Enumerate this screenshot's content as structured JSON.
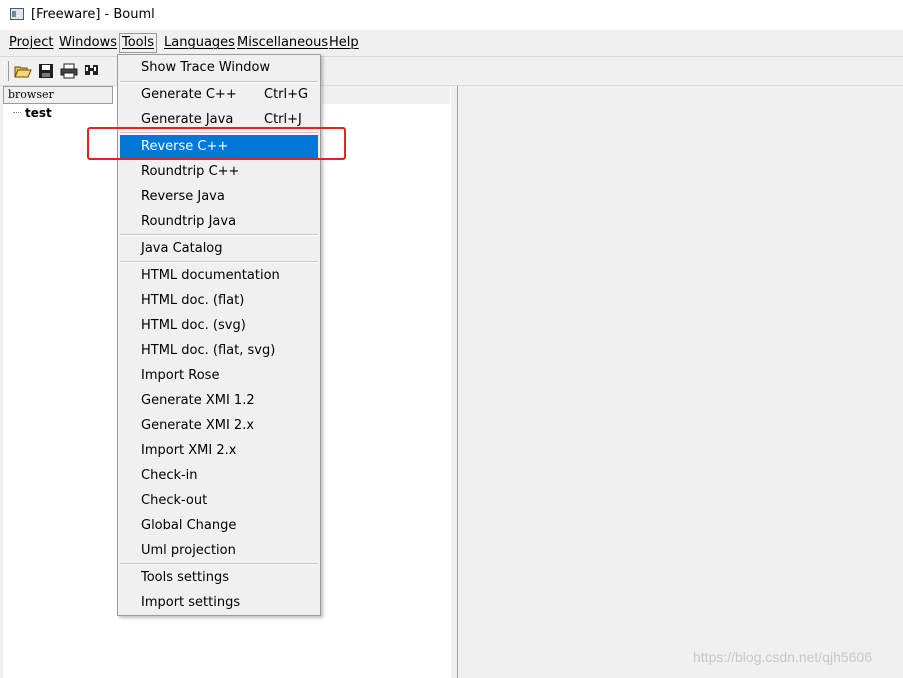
{
  "window": {
    "title": "[Freeware] - Bouml"
  },
  "menubar": {
    "items": [
      {
        "label": "Project"
      },
      {
        "label": "Windows"
      },
      {
        "label": "Tools"
      },
      {
        "label": "Languages"
      },
      {
        "label": "Miscellaneous"
      },
      {
        "label": "Help"
      }
    ]
  },
  "toolbar": {
    "buttons": [
      "open-folder-icon",
      "save-icon",
      "print-icon",
      "find-icon"
    ]
  },
  "browser": {
    "header": "browser",
    "root_node": "test"
  },
  "tools_menu": {
    "items": [
      {
        "label": "Show Trace Window",
        "shortcut": ""
      },
      {
        "label": "Generate C++",
        "shortcut": "Ctrl+G"
      },
      {
        "label": "Generate Java",
        "shortcut": "Ctrl+J"
      },
      {
        "label": "Reverse C++",
        "shortcut": "",
        "selected": true
      },
      {
        "label": "Roundtrip C++",
        "shortcut": ""
      },
      {
        "label": "Reverse Java",
        "shortcut": ""
      },
      {
        "label": "Roundtrip Java",
        "shortcut": ""
      },
      {
        "label": "Java Catalog",
        "shortcut": ""
      },
      {
        "label": "HTML documentation",
        "shortcut": ""
      },
      {
        "label": "HTML doc. (flat)",
        "shortcut": ""
      },
      {
        "label": "HTML doc. (svg)",
        "shortcut": ""
      },
      {
        "label": "HTML doc. (flat, svg)",
        "shortcut": ""
      },
      {
        "label": "Import Rose",
        "shortcut": ""
      },
      {
        "label": "Generate XMI 1.2",
        "shortcut": ""
      },
      {
        "label": "Generate XMI 2.x",
        "shortcut": ""
      },
      {
        "label": "Import XMI 2.x",
        "shortcut": ""
      },
      {
        "label": "Check-in",
        "shortcut": ""
      },
      {
        "label": "Check-out",
        "shortcut": ""
      },
      {
        "label": "Global Change",
        "shortcut": ""
      },
      {
        "label": "Uml projection",
        "shortcut": ""
      },
      {
        "label": "Tools settings",
        "shortcut": ""
      },
      {
        "label": "Import settings",
        "shortcut": ""
      }
    ],
    "highlight_color": "#0078d7"
  },
  "annotation": {
    "box_color": "#e02424"
  },
  "watermark": "https://blog.csdn.net/qjh5606"
}
